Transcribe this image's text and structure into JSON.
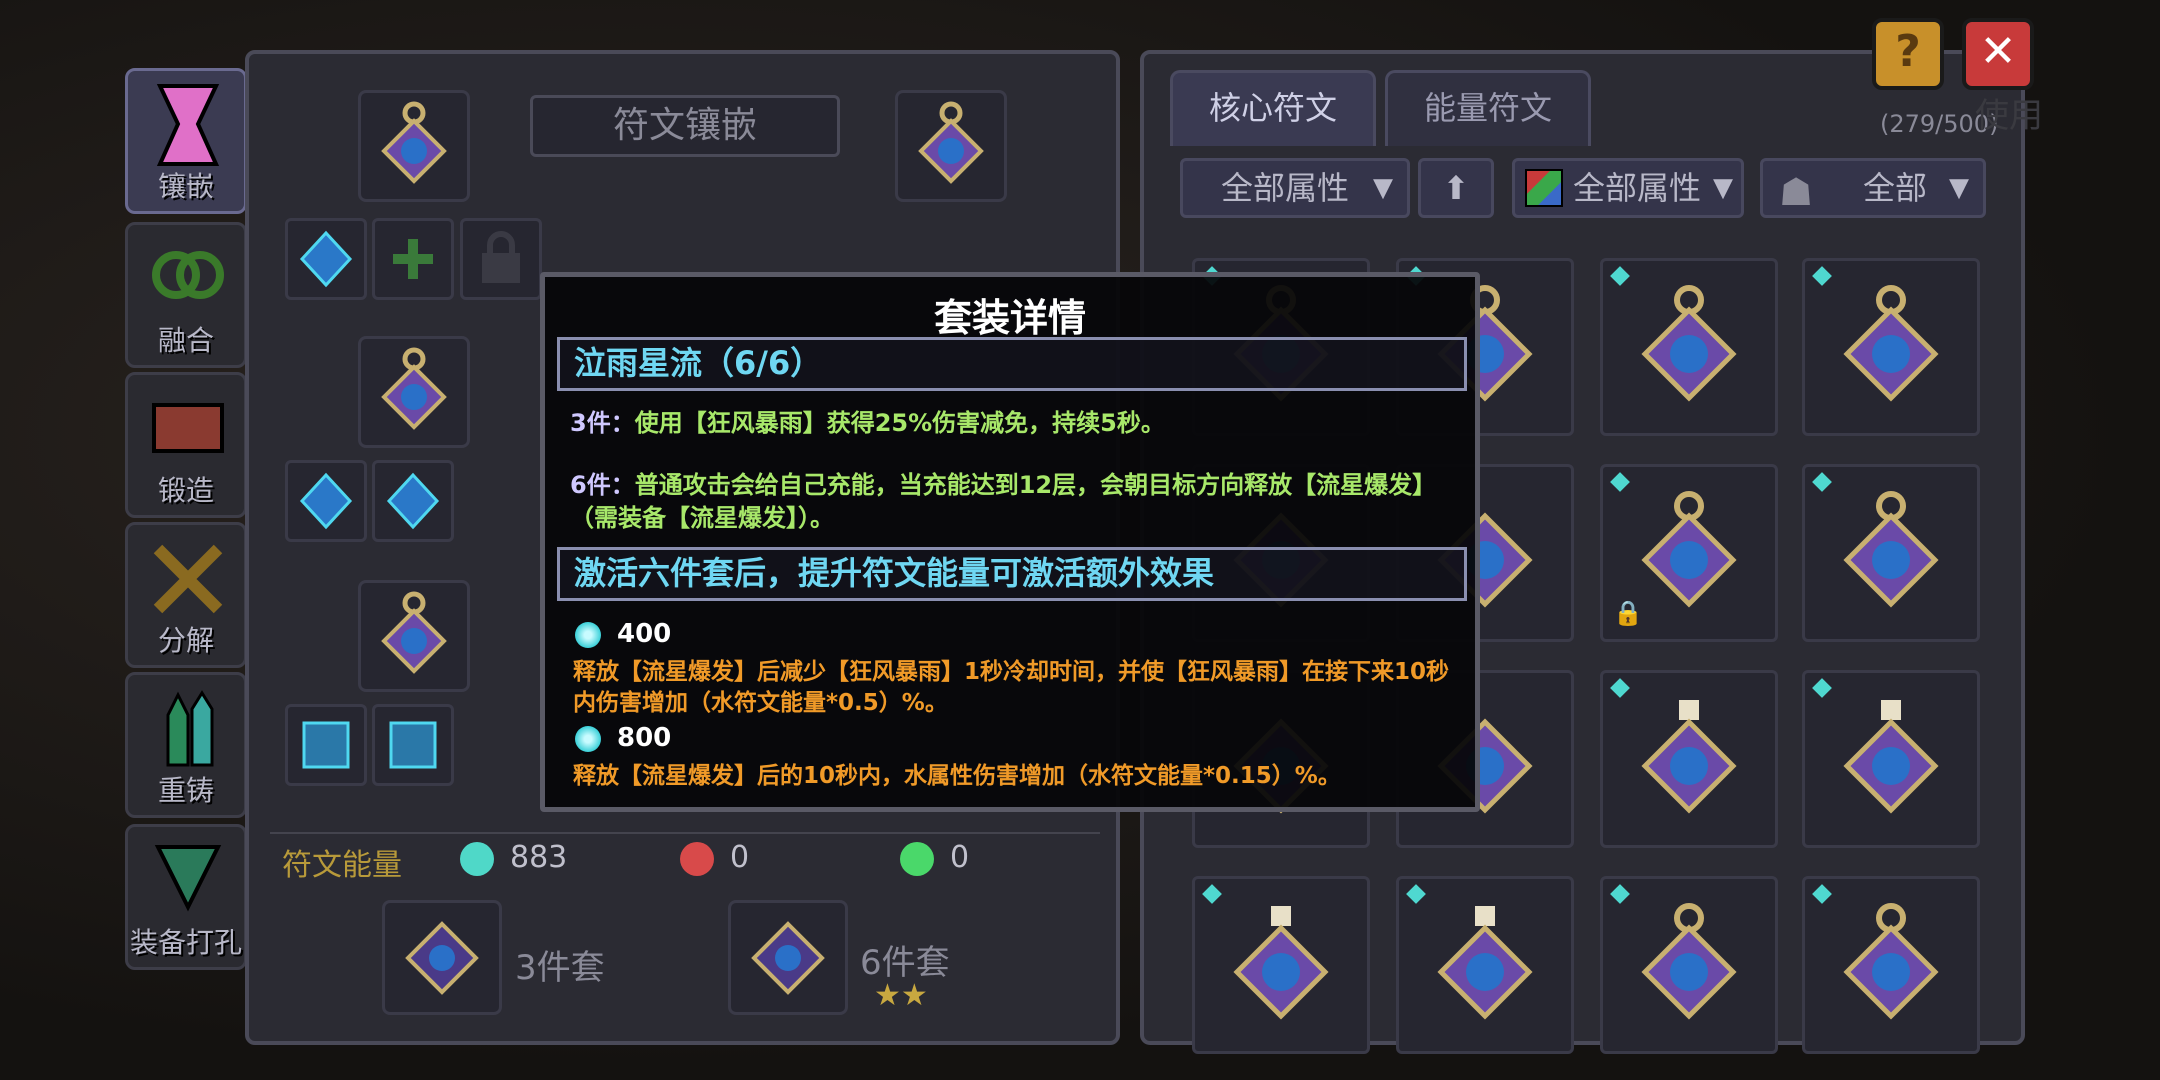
{
  "sidebar": {
    "items": [
      {
        "label": "镶嵌",
        "icon": "hourglass-icon",
        "active": true
      },
      {
        "label": "融合",
        "icon": "fusion-icon"
      },
      {
        "label": "锻造",
        "icon": "anvil-icon"
      },
      {
        "label": "分解",
        "icon": "disassemble-icon"
      },
      {
        "label": "重铸",
        "icon": "crystal-icon"
      },
      {
        "label": "装备打孔",
        "icon": "drill-icon"
      }
    ]
  },
  "left_panel": {
    "title": "符文镶嵌"
  },
  "right_panel": {
    "tabs": [
      {
        "label": "核心符文",
        "active": true
      },
      {
        "label": "能量符文",
        "active": false
      }
    ],
    "count": "(279/500)",
    "filters": {
      "attribute": "全部属性",
      "element": "全部属性",
      "type": "全部"
    },
    "background_text": "使用"
  },
  "energy": {
    "label": "符文能量",
    "items": [
      {
        "value": "883",
        "color": "#4fd8c8"
      },
      {
        "value": "0",
        "color": "#d84a4a"
      },
      {
        "value": "0",
        "color": "#4ad86a"
      }
    ]
  },
  "sets": [
    {
      "label": "3件套"
    },
    {
      "label": "6件套",
      "stars": "★★"
    }
  ],
  "modal": {
    "title": "套装详情",
    "set_name": "泣雨星流（6/6）",
    "bonus_3_key": "3件：",
    "bonus_3_text": "使用【狂风暴雨】获得25%伤害减免，持续5秒。",
    "bonus_6_key": "6件：",
    "bonus_6_text": "普通攻击会给自己充能，当充能达到12层，会朝目标方向释放【流星爆发】（需装备【流星爆发】）。",
    "extra_title": "激活六件套后，提升符文能量可激活额外效果",
    "tiers": [
      {
        "value": "400",
        "desc": "释放【流星爆发】后减少【狂风暴雨】1秒冷却时间，并使【狂风暴雨】在接下来10秒内伤害增加（水符文能量*0.5）%。"
      },
      {
        "value": "800",
        "desc": "释放【流星爆发】后的10秒内，水属性伤害增加（水符文能量*0.15）%。"
      }
    ]
  },
  "top_buttons": {
    "help": "?",
    "close": "✕"
  },
  "colors": {
    "accent": "#6fd7f2",
    "bonus_green": "#a8e86a",
    "tier_orange": "#f09a28",
    "gold": "#b89a3a"
  }
}
